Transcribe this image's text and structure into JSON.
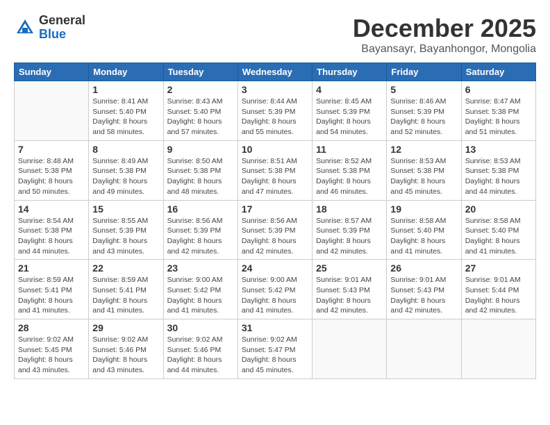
{
  "header": {
    "logo": {
      "line1": "General",
      "line2": "Blue"
    },
    "month": "December 2025",
    "location": "Bayansayr, Bayanhongor, Mongolia"
  },
  "weekdays": [
    "Sunday",
    "Monday",
    "Tuesday",
    "Wednesday",
    "Thursday",
    "Friday",
    "Saturday"
  ],
  "weeks": [
    [
      {
        "day": "",
        "info": ""
      },
      {
        "day": "1",
        "info": "Sunrise: 8:41 AM\nSunset: 5:40 PM\nDaylight: 8 hours\nand 58 minutes."
      },
      {
        "day": "2",
        "info": "Sunrise: 8:43 AM\nSunset: 5:40 PM\nDaylight: 8 hours\nand 57 minutes."
      },
      {
        "day": "3",
        "info": "Sunrise: 8:44 AM\nSunset: 5:39 PM\nDaylight: 8 hours\nand 55 minutes."
      },
      {
        "day": "4",
        "info": "Sunrise: 8:45 AM\nSunset: 5:39 PM\nDaylight: 8 hours\nand 54 minutes."
      },
      {
        "day": "5",
        "info": "Sunrise: 8:46 AM\nSunset: 5:39 PM\nDaylight: 8 hours\nand 52 minutes."
      },
      {
        "day": "6",
        "info": "Sunrise: 8:47 AM\nSunset: 5:38 PM\nDaylight: 8 hours\nand 51 minutes."
      }
    ],
    [
      {
        "day": "7",
        "info": "Sunrise: 8:48 AM\nSunset: 5:38 PM\nDaylight: 8 hours\nand 50 minutes."
      },
      {
        "day": "8",
        "info": "Sunrise: 8:49 AM\nSunset: 5:38 PM\nDaylight: 8 hours\nand 49 minutes."
      },
      {
        "day": "9",
        "info": "Sunrise: 8:50 AM\nSunset: 5:38 PM\nDaylight: 8 hours\nand 48 minutes."
      },
      {
        "day": "10",
        "info": "Sunrise: 8:51 AM\nSunset: 5:38 PM\nDaylight: 8 hours\nand 47 minutes."
      },
      {
        "day": "11",
        "info": "Sunrise: 8:52 AM\nSunset: 5:38 PM\nDaylight: 8 hours\nand 46 minutes."
      },
      {
        "day": "12",
        "info": "Sunrise: 8:53 AM\nSunset: 5:38 PM\nDaylight: 8 hours\nand 45 minutes."
      },
      {
        "day": "13",
        "info": "Sunrise: 8:53 AM\nSunset: 5:38 PM\nDaylight: 8 hours\nand 44 minutes."
      }
    ],
    [
      {
        "day": "14",
        "info": "Sunrise: 8:54 AM\nSunset: 5:38 PM\nDaylight: 8 hours\nand 44 minutes."
      },
      {
        "day": "15",
        "info": "Sunrise: 8:55 AM\nSunset: 5:39 PM\nDaylight: 8 hours\nand 43 minutes."
      },
      {
        "day": "16",
        "info": "Sunrise: 8:56 AM\nSunset: 5:39 PM\nDaylight: 8 hours\nand 42 minutes."
      },
      {
        "day": "17",
        "info": "Sunrise: 8:56 AM\nSunset: 5:39 PM\nDaylight: 8 hours\nand 42 minutes."
      },
      {
        "day": "18",
        "info": "Sunrise: 8:57 AM\nSunset: 5:39 PM\nDaylight: 8 hours\nand 42 minutes."
      },
      {
        "day": "19",
        "info": "Sunrise: 8:58 AM\nSunset: 5:40 PM\nDaylight: 8 hours\nand 41 minutes."
      },
      {
        "day": "20",
        "info": "Sunrise: 8:58 AM\nSunset: 5:40 PM\nDaylight: 8 hours\nand 41 minutes."
      }
    ],
    [
      {
        "day": "21",
        "info": "Sunrise: 8:59 AM\nSunset: 5:41 PM\nDaylight: 8 hours\nand 41 minutes."
      },
      {
        "day": "22",
        "info": "Sunrise: 8:59 AM\nSunset: 5:41 PM\nDaylight: 8 hours\nand 41 minutes."
      },
      {
        "day": "23",
        "info": "Sunrise: 9:00 AM\nSunset: 5:42 PM\nDaylight: 8 hours\nand 41 minutes."
      },
      {
        "day": "24",
        "info": "Sunrise: 9:00 AM\nSunset: 5:42 PM\nDaylight: 8 hours\nand 41 minutes."
      },
      {
        "day": "25",
        "info": "Sunrise: 9:01 AM\nSunset: 5:43 PM\nDaylight: 8 hours\nand 42 minutes."
      },
      {
        "day": "26",
        "info": "Sunrise: 9:01 AM\nSunset: 5:43 PM\nDaylight: 8 hours\nand 42 minutes."
      },
      {
        "day": "27",
        "info": "Sunrise: 9:01 AM\nSunset: 5:44 PM\nDaylight: 8 hours\nand 42 minutes."
      }
    ],
    [
      {
        "day": "28",
        "info": "Sunrise: 9:02 AM\nSunset: 5:45 PM\nDaylight: 8 hours\nand 43 minutes."
      },
      {
        "day": "29",
        "info": "Sunrise: 9:02 AM\nSunset: 5:46 PM\nDaylight: 8 hours\nand 43 minutes."
      },
      {
        "day": "30",
        "info": "Sunrise: 9:02 AM\nSunset: 5:46 PM\nDaylight: 8 hours\nand 44 minutes."
      },
      {
        "day": "31",
        "info": "Sunrise: 9:02 AM\nSunset: 5:47 PM\nDaylight: 8 hours\nand 45 minutes."
      },
      {
        "day": "",
        "info": ""
      },
      {
        "day": "",
        "info": ""
      },
      {
        "day": "",
        "info": ""
      }
    ]
  ]
}
